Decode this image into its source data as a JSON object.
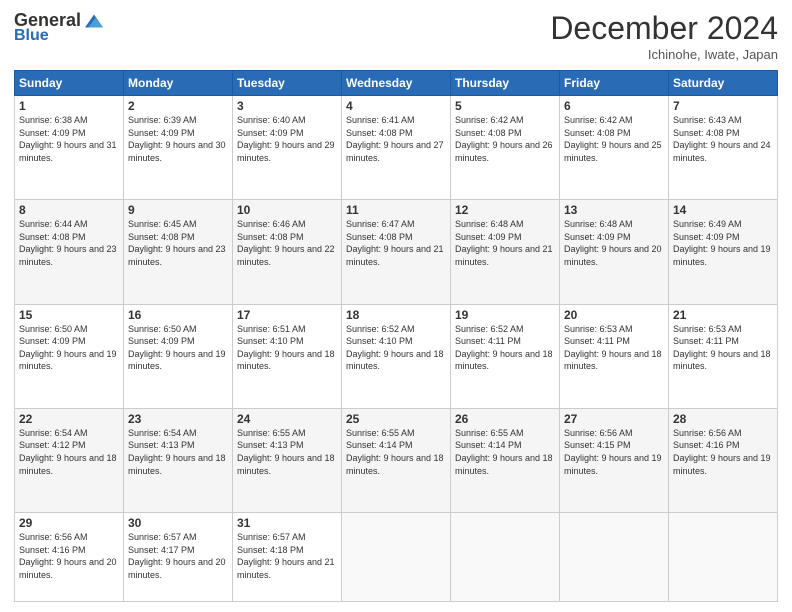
{
  "header": {
    "logo_general": "General",
    "logo_blue": "Blue",
    "month": "December 2024",
    "location": "Ichinohe, Iwate, Japan"
  },
  "days_of_week": [
    "Sunday",
    "Monday",
    "Tuesday",
    "Wednesday",
    "Thursday",
    "Friday",
    "Saturday"
  ],
  "weeks": [
    [
      {
        "day": "1",
        "sunrise": "6:38 AM",
        "sunset": "4:09 PM",
        "daylight": "9 hours and 31 minutes."
      },
      {
        "day": "2",
        "sunrise": "6:39 AM",
        "sunset": "4:09 PM",
        "daylight": "9 hours and 30 minutes."
      },
      {
        "day": "3",
        "sunrise": "6:40 AM",
        "sunset": "4:09 PM",
        "daylight": "9 hours and 29 minutes."
      },
      {
        "day": "4",
        "sunrise": "6:41 AM",
        "sunset": "4:08 PM",
        "daylight": "9 hours and 27 minutes."
      },
      {
        "day": "5",
        "sunrise": "6:42 AM",
        "sunset": "4:08 PM",
        "daylight": "9 hours and 26 minutes."
      },
      {
        "day": "6",
        "sunrise": "6:42 AM",
        "sunset": "4:08 PM",
        "daylight": "9 hours and 25 minutes."
      },
      {
        "day": "7",
        "sunrise": "6:43 AM",
        "sunset": "4:08 PM",
        "daylight": "9 hours and 24 minutes."
      }
    ],
    [
      {
        "day": "8",
        "sunrise": "6:44 AM",
        "sunset": "4:08 PM",
        "daylight": "9 hours and 23 minutes."
      },
      {
        "day": "9",
        "sunrise": "6:45 AM",
        "sunset": "4:08 PM",
        "daylight": "9 hours and 23 minutes."
      },
      {
        "day": "10",
        "sunrise": "6:46 AM",
        "sunset": "4:08 PM",
        "daylight": "9 hours and 22 minutes."
      },
      {
        "day": "11",
        "sunrise": "6:47 AM",
        "sunset": "4:08 PM",
        "daylight": "9 hours and 21 minutes."
      },
      {
        "day": "12",
        "sunrise": "6:48 AM",
        "sunset": "4:09 PM",
        "daylight": "9 hours and 21 minutes."
      },
      {
        "day": "13",
        "sunrise": "6:48 AM",
        "sunset": "4:09 PM",
        "daylight": "9 hours and 20 minutes."
      },
      {
        "day": "14",
        "sunrise": "6:49 AM",
        "sunset": "4:09 PM",
        "daylight": "9 hours and 19 minutes."
      }
    ],
    [
      {
        "day": "15",
        "sunrise": "6:50 AM",
        "sunset": "4:09 PM",
        "daylight": "9 hours and 19 minutes."
      },
      {
        "day": "16",
        "sunrise": "6:50 AM",
        "sunset": "4:09 PM",
        "daylight": "9 hours and 19 minutes."
      },
      {
        "day": "17",
        "sunrise": "6:51 AM",
        "sunset": "4:10 PM",
        "daylight": "9 hours and 18 minutes."
      },
      {
        "day": "18",
        "sunrise": "6:52 AM",
        "sunset": "4:10 PM",
        "daylight": "9 hours and 18 minutes."
      },
      {
        "day": "19",
        "sunrise": "6:52 AM",
        "sunset": "4:11 PM",
        "daylight": "9 hours and 18 minutes."
      },
      {
        "day": "20",
        "sunrise": "6:53 AM",
        "sunset": "4:11 PM",
        "daylight": "9 hours and 18 minutes."
      },
      {
        "day": "21",
        "sunrise": "6:53 AM",
        "sunset": "4:11 PM",
        "daylight": "9 hours and 18 minutes."
      }
    ],
    [
      {
        "day": "22",
        "sunrise": "6:54 AM",
        "sunset": "4:12 PM",
        "daylight": "9 hours and 18 minutes."
      },
      {
        "day": "23",
        "sunrise": "6:54 AM",
        "sunset": "4:13 PM",
        "daylight": "9 hours and 18 minutes."
      },
      {
        "day": "24",
        "sunrise": "6:55 AM",
        "sunset": "4:13 PM",
        "daylight": "9 hours and 18 minutes."
      },
      {
        "day": "25",
        "sunrise": "6:55 AM",
        "sunset": "4:14 PM",
        "daylight": "9 hours and 18 minutes."
      },
      {
        "day": "26",
        "sunrise": "6:55 AM",
        "sunset": "4:14 PM",
        "daylight": "9 hours and 18 minutes."
      },
      {
        "day": "27",
        "sunrise": "6:56 AM",
        "sunset": "4:15 PM",
        "daylight": "9 hours and 19 minutes."
      },
      {
        "day": "28",
        "sunrise": "6:56 AM",
        "sunset": "4:16 PM",
        "daylight": "9 hours and 19 minutes."
      }
    ],
    [
      {
        "day": "29",
        "sunrise": "6:56 AM",
        "sunset": "4:16 PM",
        "daylight": "9 hours and 20 minutes."
      },
      {
        "day": "30",
        "sunrise": "6:57 AM",
        "sunset": "4:17 PM",
        "daylight": "9 hours and 20 minutes."
      },
      {
        "day": "31",
        "sunrise": "6:57 AM",
        "sunset": "4:18 PM",
        "daylight": "9 hours and 21 minutes."
      },
      null,
      null,
      null,
      null
    ]
  ]
}
